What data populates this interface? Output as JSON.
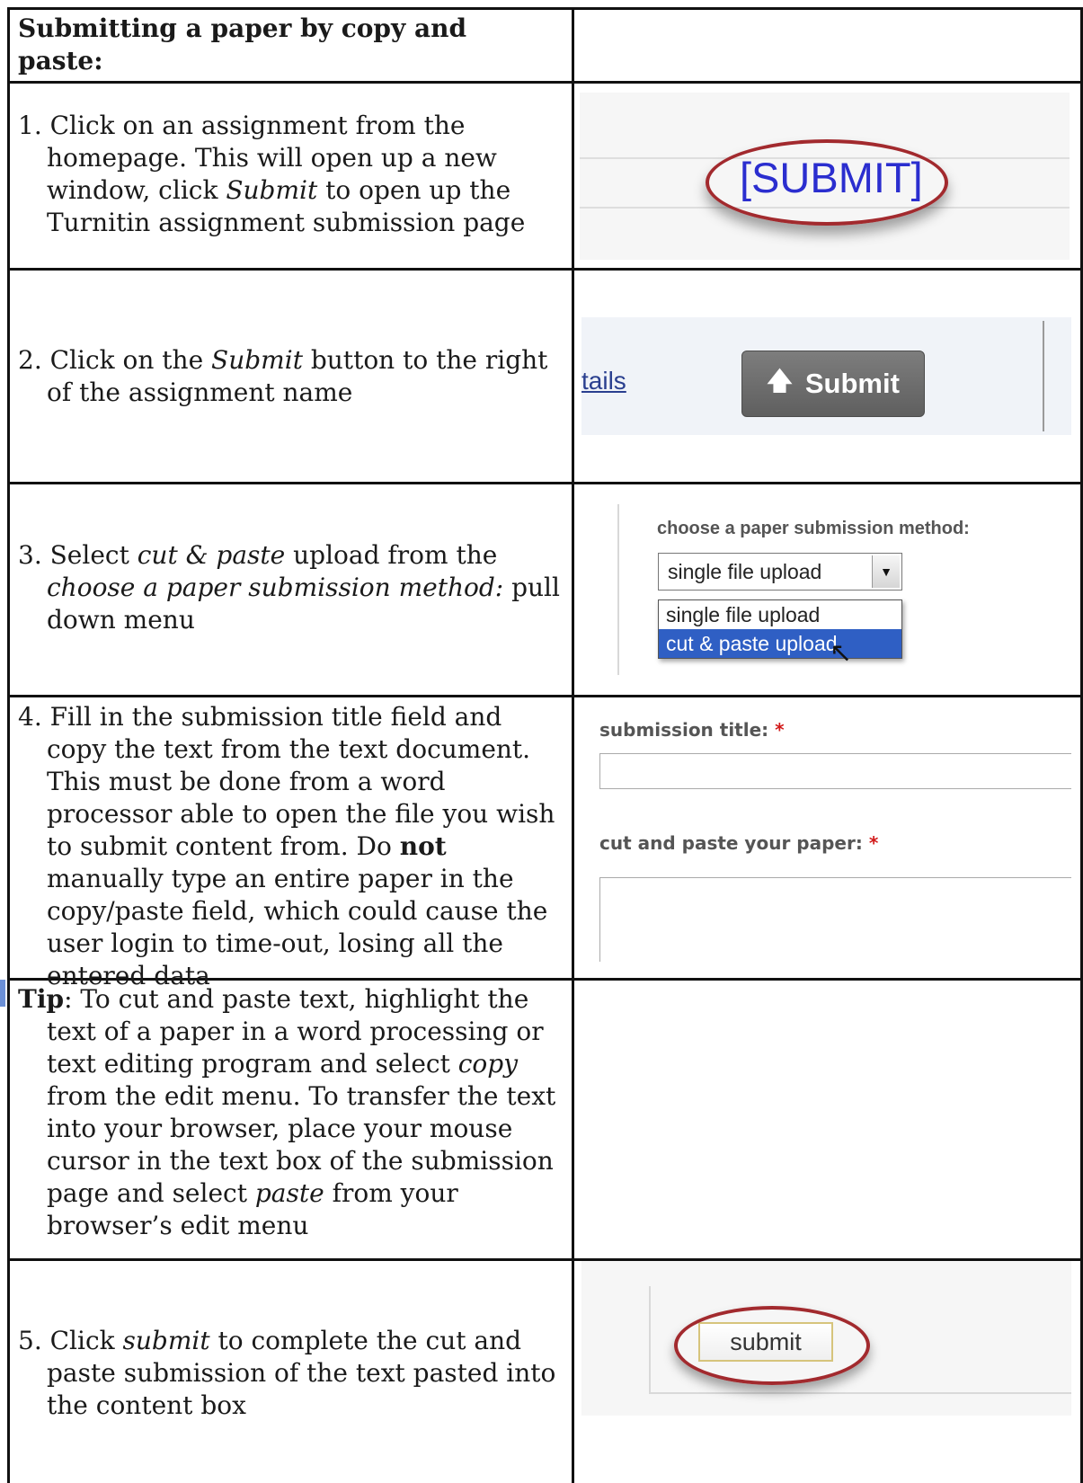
{
  "header": {
    "title": "Submitting a paper by copy and paste:"
  },
  "steps": [
    {
      "text_parts": [
        "1. Click on an assignment from the homepage. This will open up a new window, click ",
        "Submit",
        " to open up the Turnitin assignment submission page"
      ]
    },
    {
      "text_parts": [
        "2. Click on the ",
        "Submit",
        " button to the right of the assignment name"
      ]
    },
    {
      "text_parts": [
        "3. Select ",
        "cut & paste",
        " upload from the ",
        "choose a paper submission method:",
        " pull down menu"
      ]
    },
    {
      "text_parts": [
        "4. Fill in the submission title field and copy the text from the text document. This must be done from a word processor able to open the file you wish to submit content from. Do ",
        "not",
        " manually type an entire paper in the copy/paste field, which could cause the user login to time-out, losing all the entered data"
      ]
    },
    {
      "text_parts": [
        "5. Click ",
        "submit",
        " to complete the cut and paste submission of the text pasted into the content box"
      ]
    }
  ],
  "tip": {
    "label": "Tip",
    "parts": [
      ": To cut and paste text, highlight the text of a paper in a word processing or text editing program and select ",
      "copy",
      " from the edit menu. To transfer the text into your browser, place your mouse cursor in the text box of the submission page and select ",
      "paste",
      " from your browser’s edit menu"
    ]
  },
  "shot1": {
    "submit_link": "[SUBMIT]"
  },
  "shot2": {
    "details_link": "tails",
    "submit_button": "Submit"
  },
  "shot3": {
    "label": "choose a paper submission method:",
    "selected": "single file upload",
    "options": [
      "single file upload",
      "cut & paste upload"
    ]
  },
  "shot4": {
    "title_label": "submission title:",
    "paste_label": "cut and paste your paper:",
    "required_mark": "*"
  },
  "shot5": {
    "submit_button": "submit"
  },
  "colors": {
    "highlight_ring": "#a22a2e",
    "link_blue": "#2b2ecf",
    "selected_option": "#2f5fc4"
  }
}
